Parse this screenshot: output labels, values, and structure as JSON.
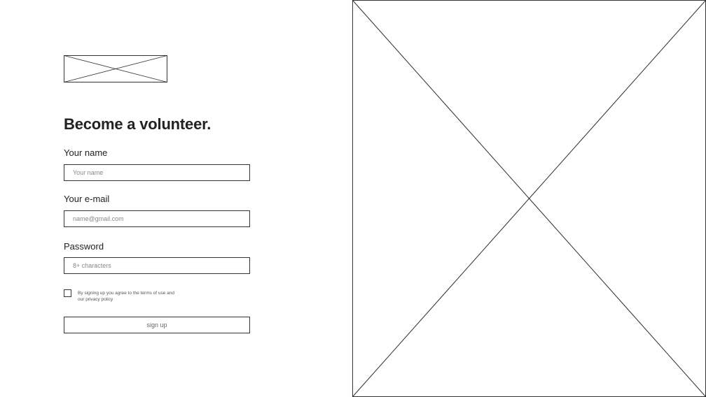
{
  "form": {
    "title": "Become a volunteer.",
    "name_field": {
      "label": "Your name",
      "placeholder": "Your name",
      "value": ""
    },
    "email_field": {
      "label": "Your e-mail",
      "placeholder": "name@gmail.com",
      "value": ""
    },
    "password_field": {
      "label": "Password",
      "placeholder": "8+ characters",
      "value": ""
    },
    "terms": {
      "checked": false,
      "text_line1": "By signing up you agree to the terms of use and",
      "text_line2": "our privacy policy"
    },
    "submit_label": "sign up"
  },
  "icons": {
    "logo": "image-placeholder-icon",
    "hero": "image-placeholder-icon"
  },
  "colors": {
    "stroke": "#333333",
    "text": "#222222",
    "placeholder_text": "#888888",
    "background": "#ffffff"
  }
}
